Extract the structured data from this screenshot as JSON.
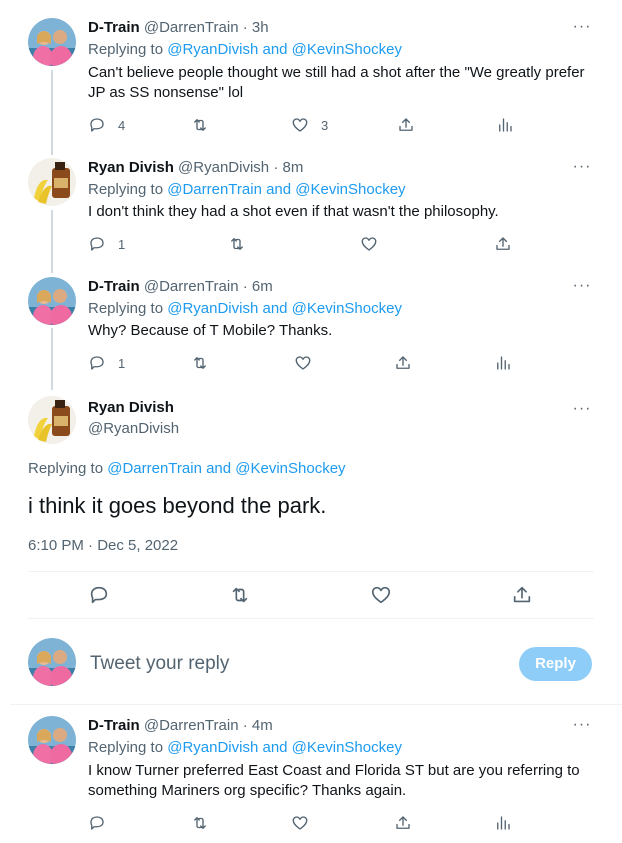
{
  "tweets": [
    {
      "display_name": "D-Train",
      "handle": "@DarrenTrain",
      "time": "· 3h",
      "replying_prefix": "Replying to ",
      "replying_to": "@RyanDivish and @KevinShockey",
      "text_line1": "Can't believe people thought we still had a shot after the \"We greatly prefer",
      "text_line2": "JP as SS nonsense\" lol",
      "replies": "4",
      "retweets": "",
      "likes": "3"
    },
    {
      "display_name": "Ryan Divish",
      "handle": "@RyanDivish",
      "time": "· 8m",
      "replying_prefix": "Replying to ",
      "replying_to": "@DarrenTrain and @KevinShockey",
      "text_line1": "I don't think they had a shot even if that wasn't the philosophy.",
      "replies": "1",
      "retweets": "",
      "likes": ""
    },
    {
      "display_name": "D-Train",
      "handle": "@DarrenTrain",
      "time": "· 6m",
      "replying_prefix": "Replying to ",
      "replying_to": "@RyanDivish and @KevinShockey",
      "text_line1": "Why?  Because of T Mobile?  Thanks.",
      "replies": "1",
      "retweets": "",
      "likes": ""
    }
  ],
  "main_tweet": {
    "display_name": "Ryan Divish",
    "handle": "@RyanDivish",
    "replying_prefix": "Replying to ",
    "replying_to": "@DarrenTrain and @KevinShockey",
    "text": "i think it goes beyond the park.",
    "timestamp": "6:10 PM · Dec 5, 2022"
  },
  "compose": {
    "placeholder": "Tweet your reply",
    "reply_button": "Reply"
  },
  "last_tweet": {
    "display_name": "D-Train",
    "handle": "@DarrenTrain",
    "time": "· 4m",
    "replying_prefix": "Replying to ",
    "replying_to": "@RyanDivish and @KevinShockey",
    "text_line1": "I know Turner preferred East Coast and Florida ST but are you referring to",
    "text_line2": "something Mariners org specific?  Thanks again."
  },
  "more_label": "···",
  "colors": {
    "link": "#1d9bf0",
    "muted": "#536471",
    "reply_button_disabled": "#8ecdf8"
  }
}
